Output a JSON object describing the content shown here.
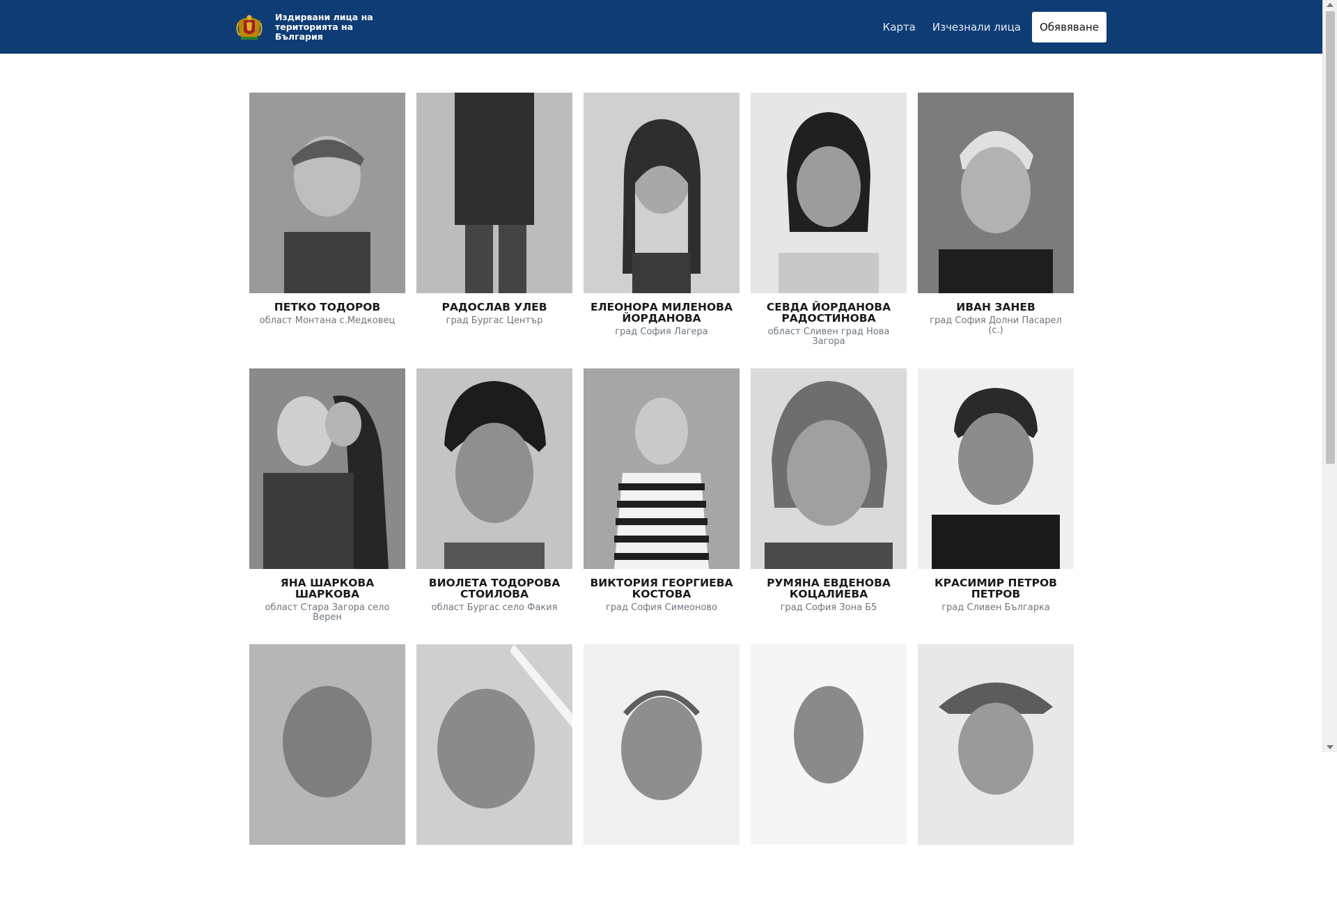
{
  "header": {
    "title": "Издирвани лица на територията на България",
    "nav": {
      "map": "Карта",
      "missing": "Изчезнали лица",
      "announce": "Обявяване"
    }
  },
  "persons": [
    {
      "name": "ПЕТКО ТОДОРОВ",
      "location": "област Монтана с.Медковец"
    },
    {
      "name": "РАДОСЛАВ УЛЕВ",
      "location": "град Бургас Център"
    },
    {
      "name": "ЕЛЕОНОРА МИЛЕНОВА ЙОРДАНОВА",
      "location": "град София Лагера"
    },
    {
      "name": "СЕВДА ЙОРДАНОВА РАДОСТИНОВА",
      "location": "област Сливен град Нова Загора"
    },
    {
      "name": "ИВАН ЗАНЕВ",
      "location": "град София Долни Пасарел (с.)"
    },
    {
      "name": "ЯНА ШАРКОВА ШАРКОВА",
      "location": "област Стара Загора село Верен"
    },
    {
      "name": "ВИОЛЕТА ТОДОРОВА СТОИЛОВА",
      "location": "област Бургас село Факия"
    },
    {
      "name": "ВИКТОРИЯ ГЕОРГИЕВА КОСТОВА",
      "location": "град София Симеоново"
    },
    {
      "name": "РУМЯНА ЕВДЕНОВА КОЦАЛИЕВА",
      "location": "град София Зона Б5"
    },
    {
      "name": "КРАСИМИР ПЕТРОВ ПЕТРОВ",
      "location": "град Сливен Българка"
    },
    {
      "name": "",
      "location": ""
    },
    {
      "name": "",
      "location": ""
    },
    {
      "name": "",
      "location": ""
    },
    {
      "name": "",
      "location": ""
    },
    {
      "name": "",
      "location": ""
    }
  ]
}
